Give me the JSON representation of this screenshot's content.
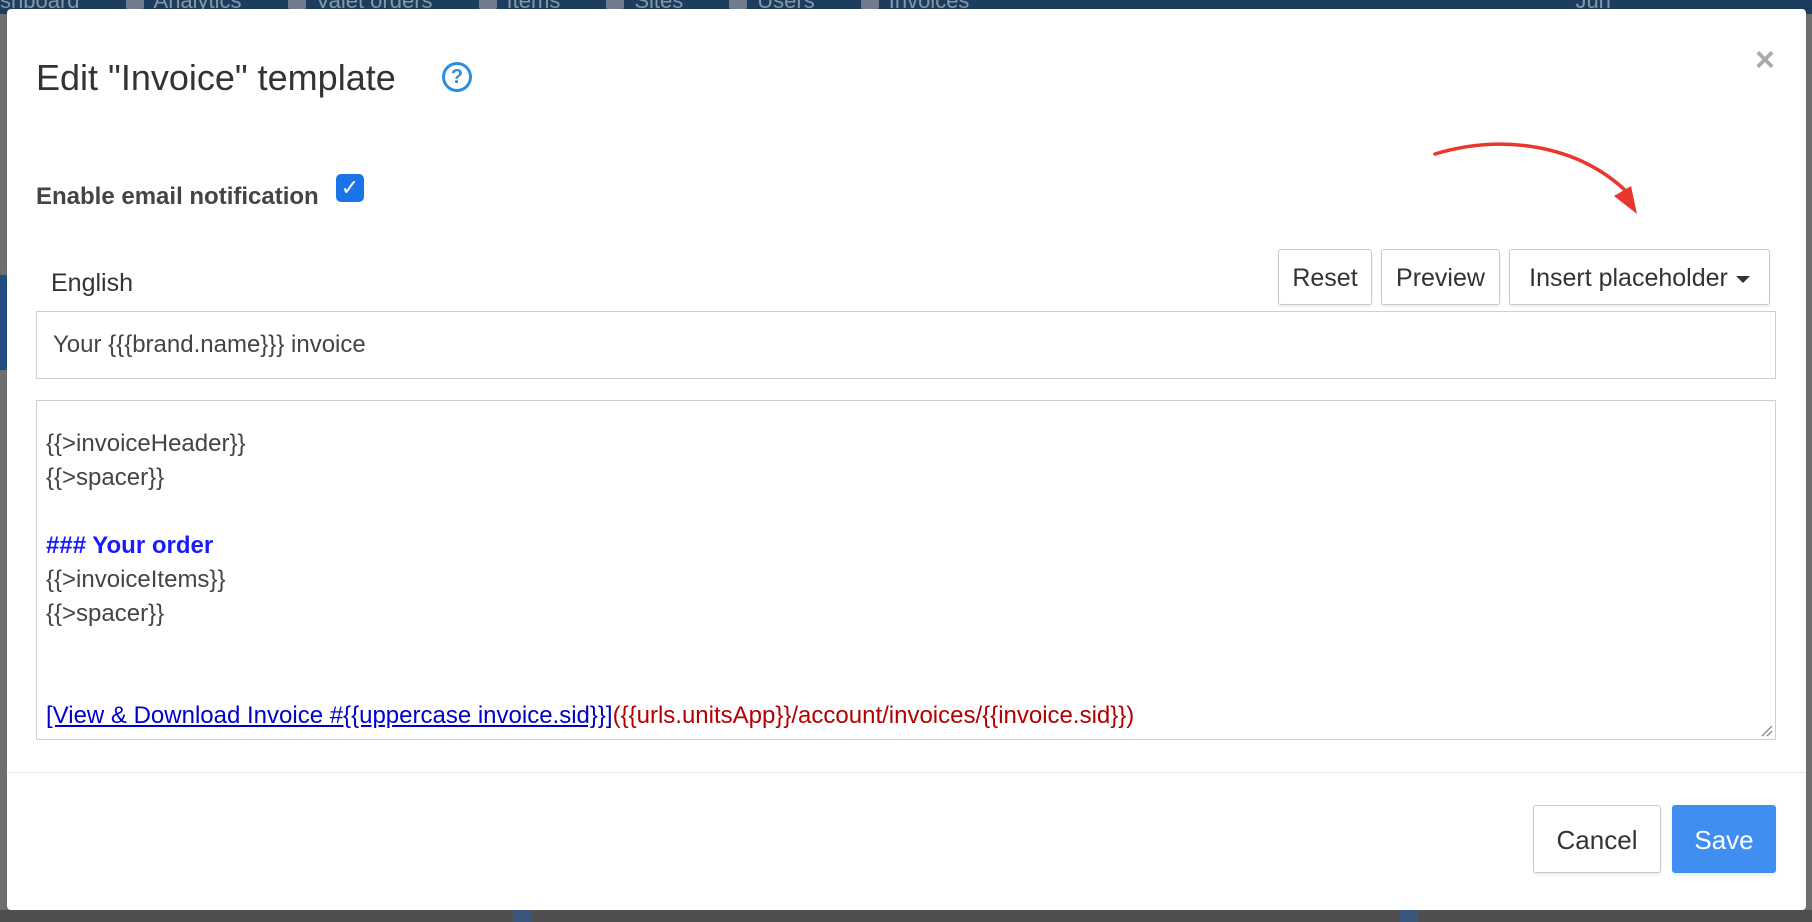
{
  "background": {
    "nav_items": [
      "shboard",
      "Analytics",
      "Valet orders",
      "Items",
      "Sites",
      "Users",
      "Invoices",
      "Jun"
    ]
  },
  "modal": {
    "title": "Edit \"Invoice\" template",
    "help_icon": "?",
    "close_icon": "×",
    "enable_notification_label": "Enable email notification",
    "enable_notification_checked": true,
    "tabs": [
      {
        "label": "English",
        "active": true
      }
    ],
    "toolbar": {
      "reset_label": "Reset",
      "preview_label": "Preview",
      "insert_placeholder_label": "Insert placeholder"
    },
    "subject_value": "Your {{{brand.name}}} invoice",
    "body_lines": [
      {
        "type": "text",
        "text": "{{>invoiceHeader}}"
      },
      {
        "type": "text",
        "text": "{{>spacer}}"
      },
      {
        "type": "text",
        "text": ""
      },
      {
        "type": "heading",
        "text": "### Your order"
      },
      {
        "type": "text",
        "text": "{{>invoiceItems}}"
      },
      {
        "type": "text",
        "text": "{{>spacer}}"
      },
      {
        "type": "text",
        "text": ""
      },
      {
        "type": "text",
        "text": ""
      },
      {
        "type": "link",
        "link_text": "[View & Download Invoice #{{uppercase invoice.sid}}]",
        "link_url": "({{urls.unitsApp}}/account/invoices/{{invoice.sid}})"
      }
    ],
    "footer": {
      "cancel_label": "Cancel",
      "save_label": "Save"
    }
  },
  "colors": {
    "primary": "#3f8ef0",
    "heading_blue": "#1a1aff",
    "link_blue": "#0000cc",
    "url_red": "#b30000",
    "annotation_arrow": "#e8372c"
  },
  "icons": {
    "help": "question-circle-icon",
    "close": "close-icon",
    "checkbox": "checkmark-icon",
    "dropdown": "caret-down-icon",
    "resize": "resize-handle-icon",
    "annotation": "red-arrow-icon"
  }
}
